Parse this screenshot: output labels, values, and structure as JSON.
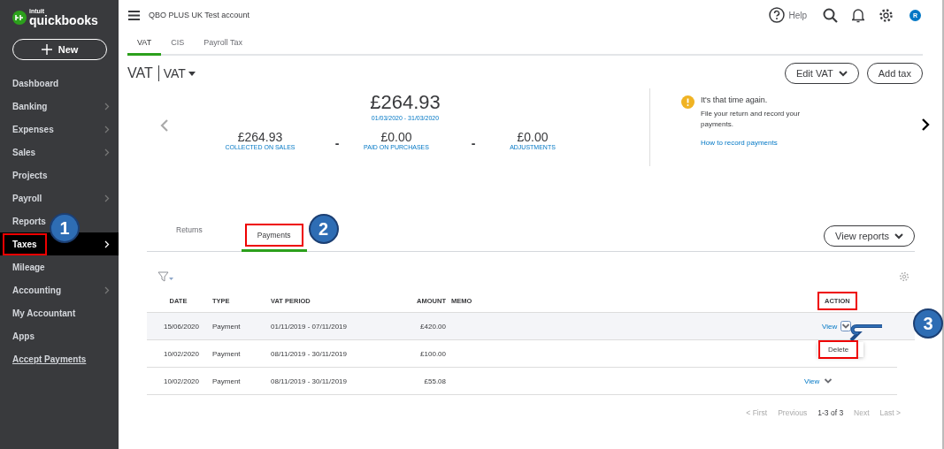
{
  "app": {
    "logo_brand": "intuit",
    "logo_name": "quickbooks",
    "new_button": "New"
  },
  "sidebar": {
    "items": [
      {
        "label": "Dashboard",
        "selected": false,
        "highlighted": false,
        "kind": "item"
      },
      {
        "label": "Banking",
        "selected": false,
        "highlighted": false,
        "kind": "group"
      },
      {
        "label": "Expenses",
        "selected": false,
        "highlighted": false,
        "kind": "group"
      },
      {
        "label": "Sales",
        "selected": false,
        "highlighted": false,
        "kind": "group"
      },
      {
        "label": "Projects",
        "selected": false,
        "highlighted": false,
        "kind": "item"
      },
      {
        "label": "Payroll",
        "selected": false,
        "highlighted": false,
        "kind": "group"
      },
      {
        "label": "Reports",
        "selected": false,
        "highlighted": false,
        "kind": "item"
      },
      {
        "label": "Taxes",
        "selected": true,
        "highlighted": true,
        "kind": "group",
        "callout": "1"
      },
      {
        "label": "Mileage",
        "selected": false,
        "highlighted": false,
        "kind": "item"
      },
      {
        "label": "Accounting",
        "selected": false,
        "highlighted": false,
        "kind": "group"
      },
      {
        "label": "My Accountant",
        "selected": false,
        "highlighted": false,
        "kind": "item"
      },
      {
        "label": "Apps",
        "selected": false,
        "highlighted": false,
        "kind": "item"
      },
      {
        "label": "Accept Payments",
        "selected": false,
        "highlighted": false,
        "kind": "link"
      }
    ]
  },
  "header": {
    "company": "QBO PLUS UK Test account",
    "help": "Help",
    "avatar": "R"
  },
  "top_tabs": [
    {
      "label": "VAT",
      "selected": true
    },
    {
      "label": "CIS",
      "selected": false
    },
    {
      "label": "Payroll Tax",
      "selected": false
    }
  ],
  "title": {
    "heading": "VAT",
    "agency": "VAT",
    "buttons": [
      {
        "label": "Edit VAT",
        "kind": "dropdown"
      },
      {
        "label": "Add tax",
        "kind": "plain"
      }
    ]
  },
  "summary": {
    "total": "£264.93",
    "period": "01/03/2020 - 31/03/2020",
    "parts": [
      {
        "value": "£264.93",
        "label": "COLLECTED ON SALES"
      },
      {
        "value": "£0.00",
        "label": "PAID ON PURCHASES"
      },
      {
        "value": "£0.00",
        "label": "ADJUSTMENTS"
      }
    ],
    "operators": [
      "-",
      "-"
    ]
  },
  "notice": {
    "title": "It's that time again.",
    "text": "File your return and record your payments.",
    "link": "How to record payments"
  },
  "sub_tabs": [
    {
      "label": "Returns",
      "selected": false,
      "highlighted": false
    },
    {
      "label": "Payments",
      "selected": true,
      "highlighted": true,
      "callout": "2"
    }
  ],
  "view_reports": "View reports",
  "table": {
    "columns": [
      {
        "label": "DATE",
        "highlighted": false
      },
      {
        "label": "TYPE",
        "highlighted": false
      },
      {
        "label": "VAT PERIOD",
        "highlighted": false
      },
      {
        "label": "AMOUNT",
        "highlighted": false
      },
      {
        "label": "MEMO",
        "highlighted": false
      },
      {
        "label": "ACTION",
        "highlighted": true
      }
    ],
    "rows": [
      {
        "cells": [
          "15/06/2020",
          "Payment",
          "01/11/2019 - 07/11/2019",
          "£420.00"
        ],
        "action": "View",
        "hovered": true,
        "menu_open": true
      },
      {
        "cells": [
          "10/02/2020",
          "Payment",
          "08/11/2019 - 30/11/2019",
          "£100.00"
        ],
        "hovered": false,
        "menu_open": false
      },
      {
        "cells": [
          "10/02/2020",
          "Payment",
          "08/11/2019 - 30/11/2019",
          "£55.08"
        ],
        "action": "View",
        "hovered": false,
        "menu_open": false
      }
    ],
    "menu": {
      "item": "Delete",
      "highlighted": true
    },
    "callout": "3"
  },
  "pager": [
    {
      "label": "< First",
      "disabled": true
    },
    {
      "label": "Previous",
      "disabled": true
    },
    {
      "label": "1-3 of 3",
      "disabled": false
    },
    {
      "label": "Next",
      "disabled": true
    },
    {
      "label": "Last >",
      "disabled": true
    }
  ]
}
